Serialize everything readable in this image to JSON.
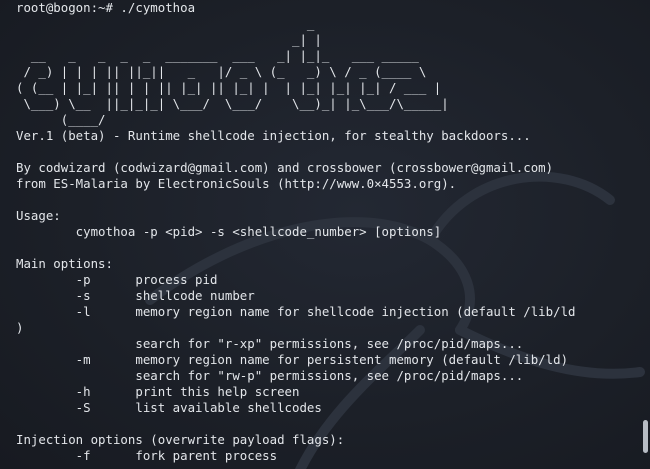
{
  "terminal": {
    "prompt": "root@bogon:~# ./cymothoa",
    "banner": [
      "                                       _",
      "                                     _| |",
      "  __   _   _  _  _  _______  ___   _| |_|_   ___ _____",
      " / _) | | | || ||_||   _   |/ _ \\ (_   _) \\ / _ (____ \\",
      "( (__ | |_| || | | || |_| || |_| |  | |_| |_| |_| / ___ |",
      " \\___) \\__  ||_|_|_| \\___/  \\___/    \\__)_| |_\\___/\\_____|",
      "      (____/"
    ],
    "lines": [
      "Ver.1 (beta) - Runtime shellcode injection, for stealthy backdoors...",
      "",
      "By codwizard (codwizard@gmail.com) and crossbower (crossbower@gmail.com)",
      "from ES-Malaria by ElectronicSouls (http://www.0×4553.org).",
      "",
      "Usage:",
      "        cymothoa -p <pid> -s <shellcode_number> [options]",
      "",
      "Main options:",
      "        -p      process pid",
      "        -s      shellcode number",
      "        -l      memory region name for shellcode injection (default /lib/ld",
      ")",
      "                search for \"r-xp\" permissions, see /proc/pid/maps...",
      "        -m      memory region name for persistent memory (default /lib/ld)",
      "                search for \"rw-p\" permissions, see /proc/pid/maps...",
      "        -h      print this help screen",
      "        -S      list available shellcodes",
      "",
      "Injection options (overwrite payload flags):",
      "        -f      fork parent process"
    ]
  },
  "colors": {
    "text": "#e3e6ea",
    "background": "#1b1f27",
    "scrollbar_thumb": "#b7bcc4"
  },
  "icons": {
    "background_logo": "kali-dragon-icon"
  }
}
